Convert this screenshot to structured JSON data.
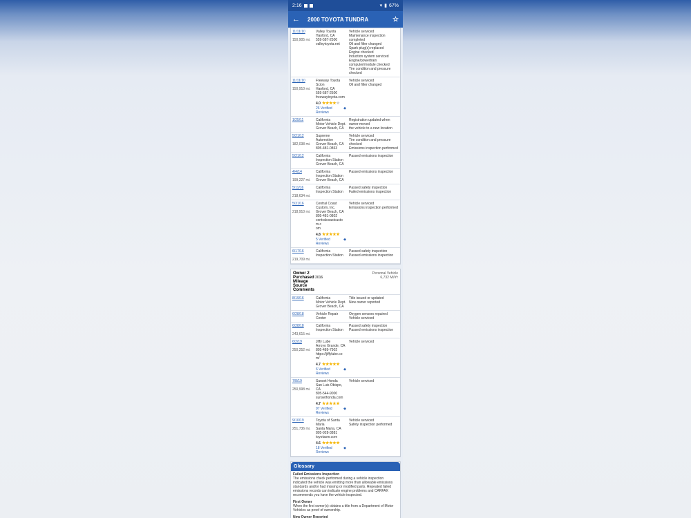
{
  "status": {
    "time": "2:16",
    "battery": "67%"
  },
  "appbar": {
    "title": "2000 TOYOTA TUNDRA"
  },
  "owner1_records": [
    {
      "date": "11/11/10",
      "miles": "150,905 mi.",
      "source": [
        "Valley Toyota",
        "Hanford, CA",
        "559-587-2500",
        "valleytoyota.net"
      ],
      "comments": [
        "Vehicle serviced",
        "Maintenance inspection completed",
        "Oil and filter changed",
        "Spark plug(s) replaced",
        "Engine checked",
        "Induction system serviced",
        "Engine/powertrain computer/module checked",
        "Tire condition and pressure checked"
      ]
    },
    {
      "date": "11/11/10",
      "miles": "150,910 mi.",
      "source": [
        "Freeway Toyota",
        "Scion",
        "Hanford, CA",
        "559-587-2500",
        "freewaytoyota.com"
      ],
      "rating": "4.0",
      "stars": 4,
      "reviews": "26 Verified Reviews",
      "comments": [
        "Vehicle serviced",
        "Oil and filter changed"
      ]
    },
    {
      "date": "1/25/11",
      "miles": "",
      "source": [
        "California",
        "Motor Vehicle Dept.",
        "Grover Beach, CA"
      ],
      "comments": [
        "Registration updated when owner moved",
        "the vehicle to a new location"
      ]
    },
    {
      "date": "5/21/12",
      "miles": "182,038 mi.",
      "source": [
        "Supreme",
        "Automotive",
        "Grover Beach, CA",
        "805-481-0863"
      ],
      "comments": [
        "Vehicle serviced",
        "Tire condition and pressure checked",
        "Emissions inspection performed"
      ]
    },
    {
      "date": "5/21/12",
      "miles": "",
      "source": [
        "California",
        "Inspection Station",
        "Grover Beach, CA"
      ],
      "comments": [
        "Passed emissions inspection"
      ]
    },
    {
      "date": "4/4/14",
      "miles": "199,227 mi.",
      "source": [
        "California",
        "Inspection Station",
        "Grover Beach, CA"
      ],
      "comments": [
        "Passed emissions inspection"
      ]
    },
    {
      "date": "5/11/16",
      "miles": "218,634 mi.",
      "source": [
        "California",
        "Inspection Station"
      ],
      "comments": [
        "Passed safety inspection",
        "Failed emissions inspection"
      ]
    },
    {
      "date": "5/31/16",
      "miles": "218,910 mi.",
      "source": [
        "Central Coast",
        "Custom, Inc.",
        "Grover Beach, CA",
        "805-481-0802",
        "centralcoastcusto",
        "m.c",
        "om"
      ],
      "rating": "4.8",
      "stars": 5,
      "reviews": "5 Verified Reviews",
      "comments": [
        "Vehicle serviced",
        "Emissions inspection performed"
      ]
    },
    {
      "date": "6/17/16",
      "miles": "219,709 mi.",
      "source": [
        "California",
        "Inspection Station"
      ],
      "comments": [
        "Passed safety inspection",
        "Passed emissions inspection"
      ]
    }
  ],
  "owner2": {
    "title": "Owner 2",
    "purchased_label": "Purchased",
    "purchased": "2016",
    "type": "Personal Vehicle",
    "miles_per_year": "6,732 Mi/Yr",
    "mileage_label": "Mileage",
    "source_label": "Source",
    "comments_label": "Comments"
  },
  "owner2_records": [
    {
      "date": "8/19/16",
      "miles": "",
      "source": [
        "California",
        "Motor Vehicle Dept.",
        "Grover Beach, CA"
      ],
      "comments": [
        "Title issued or updated",
        "New owner reported"
      ]
    },
    {
      "date": "6/28/18",
      "miles": "",
      "source": [
        "Vehicle Repair",
        "Center"
      ],
      "comments": [
        "Oxygen sensors repaired",
        "Vehicle serviced"
      ]
    },
    {
      "date": "6/28/18",
      "miles": "243,615 mi.",
      "source": [
        "California",
        "Inspection Station"
      ],
      "comments": [
        "Passed safety inspection",
        "Passed emissions inspection"
      ]
    },
    {
      "date": "6/2/19",
      "miles": "250,252 mi.",
      "source": [
        "Jiffy Lube",
        "Arroyo Grande, CA",
        "805-489-7902",
        "https://jiffylube.co",
        "m/"
      ],
      "rating": "4.7",
      "stars": 5,
      "reviews": "6 Verified Reviews",
      "comments": [
        "Vehicle serviced"
      ]
    },
    {
      "date": "7/8/19",
      "miles": "250,998 mi.",
      "source": [
        "Sunset Honda",
        "San Luis Obispo,",
        "CA",
        "805-544-9000",
        "sunsethonda.com"
      ],
      "rating": "4.7",
      "stars": 5,
      "reviews": "97 Verified Reviews",
      "comments": [
        "Vehicle serviced"
      ]
    },
    {
      "date": "9/10/19",
      "miles": "251,736 mi.",
      "source": [
        "Toyota of Santa",
        "Maria",
        "Santa Maria, CA",
        "805-928-3881",
        "toyotasm.com"
      ],
      "rating": "4.6",
      "stars": 5,
      "reviews": "18 Verified Reviews",
      "comments": [
        "Vehicle serviced",
        "Safety inspection performed"
      ]
    }
  ],
  "glossary": {
    "title": "Glossary",
    "items": [
      {
        "term": "Failed Emissions Inspection",
        "text": "The emissions check performed during a vehicle inspection indicated the vehicle was emitting more than allowable emissions standards and/or had missing or modified parts. Repeated failed emissions records can indicate engine problems and CARFAX recommends you have the vehicle inspected."
      },
      {
        "term": "First Owner",
        "text": "When the first owner(s) obtains a title from a Department of Motor Vehicles as proof of ownership."
      },
      {
        "term": "New Owner Reported",
        "text": "When a vehicle is sold to a new owner, the Title must be transferred to the new owner(s) at a Department of Motor Vehicles."
      }
    ]
  }
}
